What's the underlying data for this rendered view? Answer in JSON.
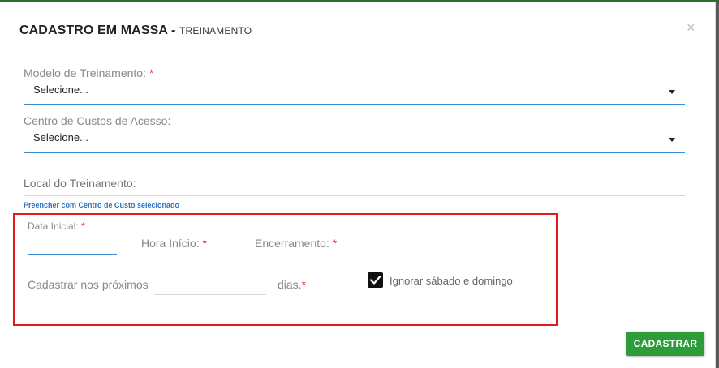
{
  "modal": {
    "title": "CADASTRO EM MASSA -",
    "subtitle": "TREINAMENTO",
    "close_glyph": "×"
  },
  "required_mark": "*",
  "modelo": {
    "label": "Modelo de Treinamento:",
    "value": "Selecione..."
  },
  "centro": {
    "label": "Centro de Custos de Acesso:",
    "value": "Selecione..."
  },
  "local": {
    "placeholder": "Local do Treinamento:",
    "value": ""
  },
  "link": {
    "text": "Preencher com Centro de Custo selecionado"
  },
  "data_inicial": {
    "label": "Data Inicial:",
    "value": ""
  },
  "hora_inicio": {
    "placeholder": "Hora Início:",
    "value": ""
  },
  "encerramento": {
    "placeholder": "Encerramento:",
    "value": ""
  },
  "proximos": {
    "label": "Cadastrar nos próximos",
    "value": "",
    "suffix": "dias."
  },
  "ignorar": {
    "label": "Ignorar sábado e domingo",
    "checked": true
  },
  "submit": {
    "label": "CADASTRAR"
  },
  "colors": {
    "accent": "#3f8fd6",
    "required": "#e53935",
    "submit": "#2e9c3a",
    "highlight": "#e8191b",
    "link": "#2f6fb8"
  }
}
